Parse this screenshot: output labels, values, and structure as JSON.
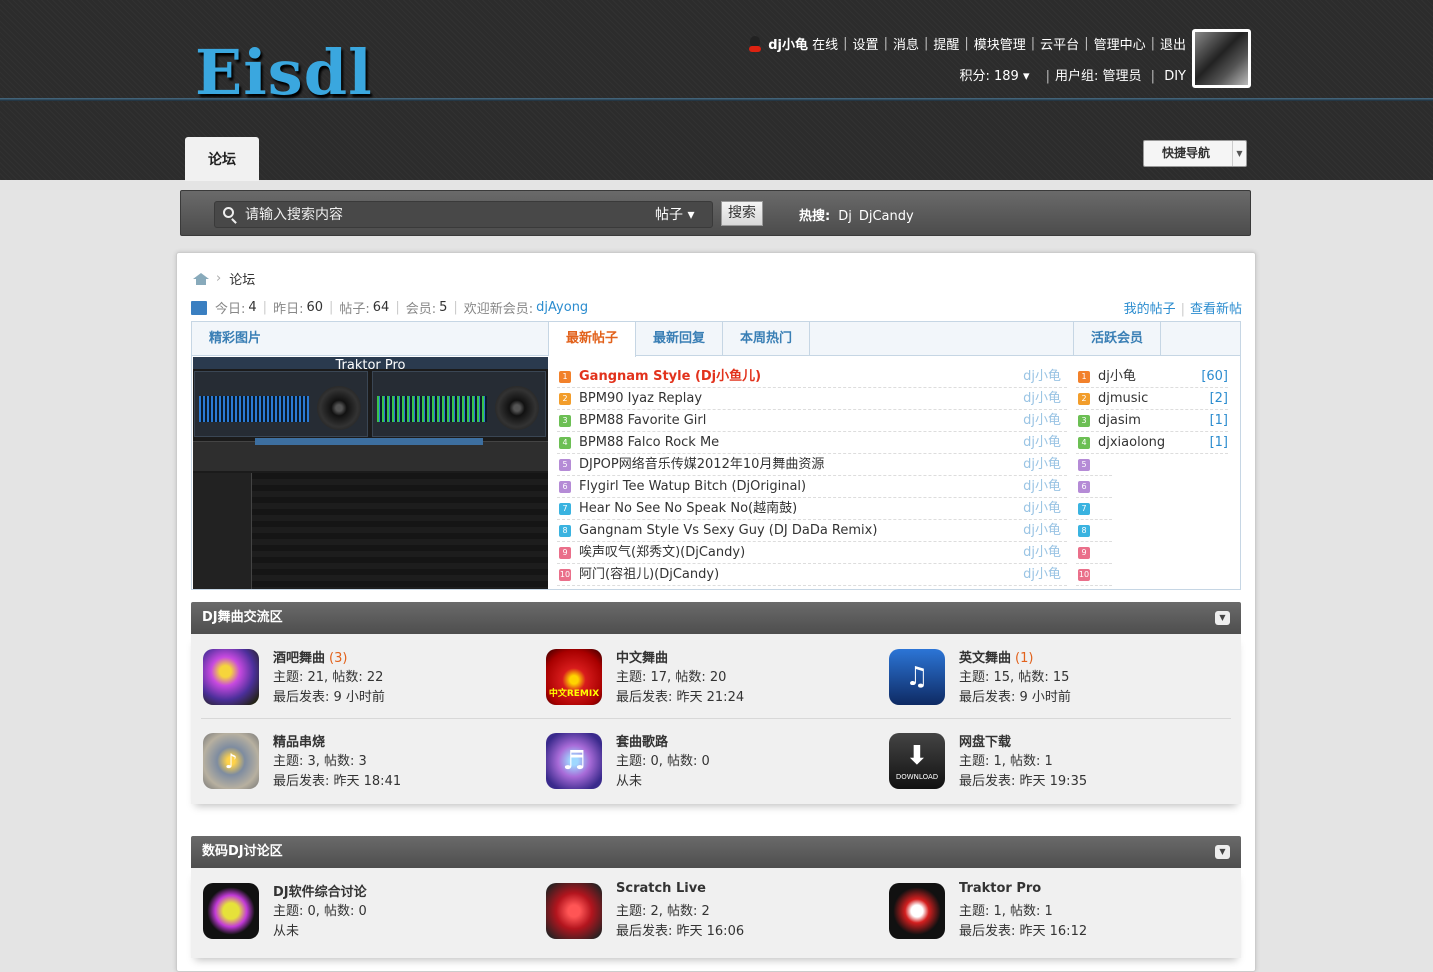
{
  "header": {
    "logo": "Eisdl",
    "username": "dj小龟",
    "status": "在线",
    "menu": [
      "设置",
      "消息",
      "提醒",
      "模块管理",
      "云平台",
      "管理中心",
      "退出"
    ],
    "points_label": "积分: 189",
    "group_label": "用户组: 管理员",
    "diy": "DIY"
  },
  "nav": {
    "forum_tab": "论坛",
    "quick_nav": "快捷导航"
  },
  "search": {
    "placeholder": "请输入搜索内容",
    "type": "帖子",
    "button": "搜索",
    "hot_label": "热搜:",
    "hot": [
      "Dj",
      "DjCandy"
    ]
  },
  "breadcrumb": {
    "current": "论坛"
  },
  "stats": {
    "today_label": "今日:",
    "today": "4",
    "yesterday_label": "昨日:",
    "yesterday": "60",
    "posts_label": "帖子:",
    "posts": "64",
    "members_label": "会员:",
    "members": "5",
    "welcome_label": "欢迎新会员:",
    "new_member": "djAyong",
    "my_posts": "我的帖子",
    "new_posts": "查看新帖"
  },
  "grid": {
    "pics_title": "精彩图片",
    "pic_caption": "Traktor Pro",
    "tabs": [
      "最新帖子",
      "最新回复",
      "本周热门"
    ],
    "members_title": "活跃会员",
    "threads": [
      {
        "title": "Gangnam Style (Dj小鱼儿)",
        "author": "dj小龟"
      },
      {
        "title": "BPM90 Iyaz Replay",
        "author": "dj小龟"
      },
      {
        "title": "BPM88 Favorite Girl",
        "author": "dj小龟"
      },
      {
        "title": "BPM88 Falco Rock Me",
        "author": "dj小龟"
      },
      {
        "title": "DJPOP网络音乐传媒2012年10月舞曲资源",
        "author": "dj小龟"
      },
      {
        "title": "Flygirl Tee Watup Bitch (DjOriginal)",
        "author": "dj小龟"
      },
      {
        "title": "Hear No See No Speak No(越南鼓)",
        "author": "dj小龟"
      },
      {
        "title": "Gangnam Style Vs Sexy Guy (DJ DaDa Remix)",
        "author": "dj小龟"
      },
      {
        "title": "唉声叹气(郑秀文)(DjCandy)",
        "author": "dj小龟"
      },
      {
        "title": "阿门(容祖儿)(DjCandy)",
        "author": "dj小龟"
      }
    ],
    "members": [
      {
        "name": "dj小龟",
        "count": "[60]"
      },
      {
        "name": "djmusic",
        "count": "[2]"
      },
      {
        "name": "djasim",
        "count": "[1]"
      },
      {
        "name": "djxiaolong",
        "count": "[1]"
      }
    ]
  },
  "sections": [
    {
      "title": "DJ舞曲交流区",
      "forums": [
        {
          "name": "酒吧舞曲",
          "today": "(3)",
          "stats": "主题: 21, 帖数: 22",
          "last": "最后发表: 9 小时前"
        },
        {
          "name": "中文舞曲",
          "today": "",
          "stats": "主题: 17, 帖数: 20",
          "last": "最后发表: 昨天 21:24"
        },
        {
          "name": "英文舞曲",
          "today": "(1)",
          "stats": "主题: 15, 帖数: 15",
          "last": "最后发表: 9 小时前"
        },
        {
          "name": "精品串烧",
          "today": "",
          "stats": "主题: 3, 帖数: 3",
          "last": "最后发表: 昨天 18:41"
        },
        {
          "name": "套曲歌路",
          "today": "",
          "stats": "主题: 0, 帖数: 0",
          "last": "从未"
        },
        {
          "name": "网盘下载",
          "today": "",
          "stats": "主题: 1, 帖数: 1",
          "last": "最后发表: 昨天 19:35"
        }
      ]
    },
    {
      "title": "数码DJ讨论区",
      "forums": [
        {
          "name": "DJ软件综合讨论",
          "today": "",
          "stats": "主题: 0, 帖数: 0",
          "last": "从未"
        },
        {
          "name": "Scratch Live",
          "today": "",
          "stats": "主题: 2, 帖数: 2",
          "last": "最后发表: 昨天 16:06"
        },
        {
          "name": "Traktor Pro",
          "today": "",
          "stats": "主题: 1, 帖数: 1",
          "last": "最后发表: 昨天 16:12"
        }
      ]
    }
  ],
  "icons": {
    "cn_remix": "中文REMIX",
    "download": "DOWNLOAD"
  }
}
